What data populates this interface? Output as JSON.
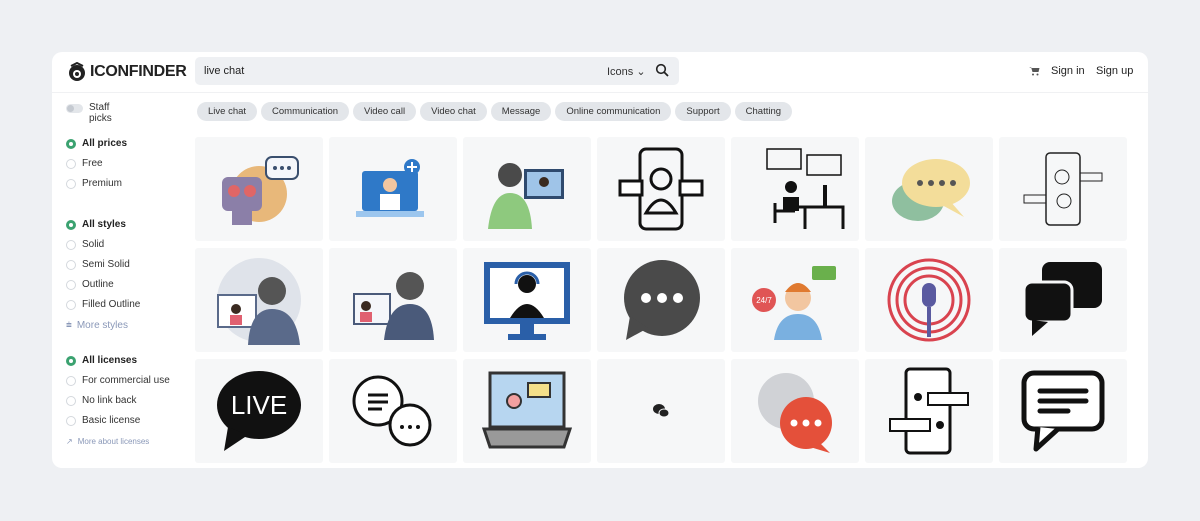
{
  "header": {
    "logo": "ICONFINDER",
    "search_value": "live chat",
    "search_type": "Icons",
    "sign_in": "Sign in",
    "sign_up": "Sign up"
  },
  "sidebar": {
    "staff_picks": "Staff picks",
    "prices": [
      {
        "label": "All prices",
        "selected": true
      },
      {
        "label": "Free",
        "selected": false
      },
      {
        "label": "Premium",
        "selected": false
      }
    ],
    "styles": [
      {
        "label": "All styles",
        "selected": true
      },
      {
        "label": "Solid",
        "selected": false
      },
      {
        "label": "Semi Solid",
        "selected": false
      },
      {
        "label": "Outline",
        "selected": false
      },
      {
        "label": "Filled Outline",
        "selected": false
      }
    ],
    "more_styles": "More styles",
    "licenses": [
      {
        "label": "All licenses",
        "selected": true
      },
      {
        "label": "For commercial use",
        "selected": false
      },
      {
        "label": "No link back",
        "selected": false
      },
      {
        "label": "Basic license",
        "selected": false
      }
    ],
    "more_licenses": "More about licenses"
  },
  "tags": [
    "Live chat",
    "Communication",
    "Video call",
    "Video chat",
    "Message",
    "Online communication",
    "Support",
    "Chatting"
  ],
  "icons": [
    "robot-chat",
    "video-call-doctor",
    "video-call-person",
    "phone-chat-person",
    "desk-chat-outline",
    "speech-bubbles-color",
    "phone-chat-outline",
    "video-call-round",
    "video-call-woman",
    "support-monitor",
    "speech-bubble-dots",
    "support-24-7",
    "microphone-broadcast",
    "chat-bubbles-solid",
    "live-bubble",
    "chat-bubbles-outline",
    "laptop-video-chat",
    "chat-small",
    "chat-bubbles-gray-red",
    "phone-chat-users",
    "message-bubble"
  ],
  "live_text": "LIVE",
  "support_text": "24/7",
  "colors": {
    "accent": "#3ba270",
    "tag": "#e3e6ea"
  }
}
